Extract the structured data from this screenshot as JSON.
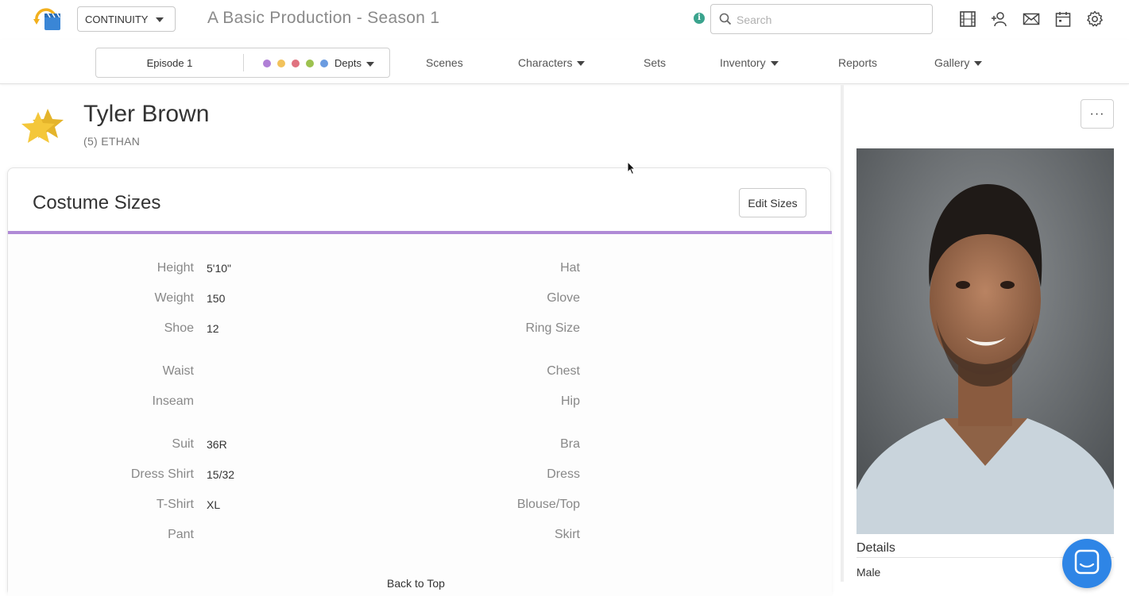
{
  "header": {
    "app_select_value": "CONTINUITY",
    "production_title": "A Basic Production - Season 1",
    "search_placeholder": "Search",
    "icons": [
      "film-strip-icon",
      "add-person-icon",
      "mail-icon",
      "calendar-icon",
      "settings-gear-icon"
    ]
  },
  "nav": {
    "episode": "Episode 1",
    "dept_dot_colors": [
      "#b07fd6",
      "#f2c25b",
      "#e0727f",
      "#9dc24f",
      "#6a9be0"
    ],
    "depts_label": "Depts",
    "items": [
      "Scenes",
      "Characters",
      "Sets",
      "Inventory",
      "Reports",
      "Gallery"
    ]
  },
  "character": {
    "name": "Tyler Brown",
    "role": "(5) ETHAN"
  },
  "costume": {
    "title": "Costume Sizes",
    "edit_label": "Edit Sizes",
    "accent_color": "#b08ad6",
    "left": [
      {
        "label": "Height",
        "value": "5'10\""
      },
      {
        "label": "Weight",
        "value": "150"
      },
      {
        "label": "Shoe",
        "value": "12"
      },
      {
        "label": "Waist",
        "value": ""
      },
      {
        "label": "Inseam",
        "value": ""
      },
      {
        "label": "Suit",
        "value": "36R"
      },
      {
        "label": "Dress Shirt",
        "value": "15/32"
      },
      {
        "label": "T-Shirt",
        "value": "XL"
      },
      {
        "label": "Pant",
        "value": ""
      }
    ],
    "right": [
      {
        "label": "Hat",
        "value": ""
      },
      {
        "label": "Glove",
        "value": ""
      },
      {
        "label": "Ring Size",
        "value": ""
      },
      {
        "label": "Chest",
        "value": ""
      },
      {
        "label": "Hip",
        "value": ""
      },
      {
        "label": "Bra",
        "value": ""
      },
      {
        "label": "Dress",
        "value": ""
      },
      {
        "label": "Blouse/Top",
        "value": ""
      },
      {
        "label": "Skirt",
        "value": ""
      }
    ],
    "back_to_top": "Back to Top"
  },
  "sidebar": {
    "more_label": "···",
    "details_heading": "Details",
    "gender": "Male"
  }
}
